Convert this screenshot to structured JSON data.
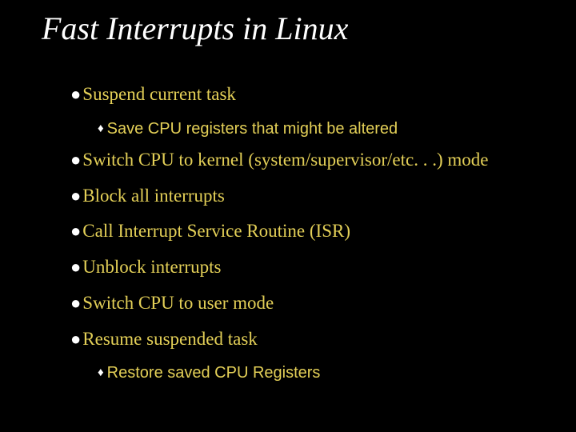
{
  "title": "Fast Interrupts in Linux",
  "items": [
    {
      "level": 1,
      "text": "Suspend current task"
    },
    {
      "level": 2,
      "text": "Save CPU registers that might be altered"
    },
    {
      "level": 1,
      "text": "Switch CPU to kernel (system/supervisor/etc. . .) mode"
    },
    {
      "level": 1,
      "text": "Block all interrupts"
    },
    {
      "level": 1,
      "text": "Call Interrupt Service Routine (ISR)"
    },
    {
      "level": 1,
      "text": "Unblock interrupts"
    },
    {
      "level": 1,
      "text": "Switch CPU to user mode"
    },
    {
      "level": 1,
      "text": "Resume suspended task"
    },
    {
      "level": 2,
      "text": "Restore saved CPU Registers"
    }
  ],
  "bullets": {
    "l1": "●",
    "l2": "♦"
  }
}
